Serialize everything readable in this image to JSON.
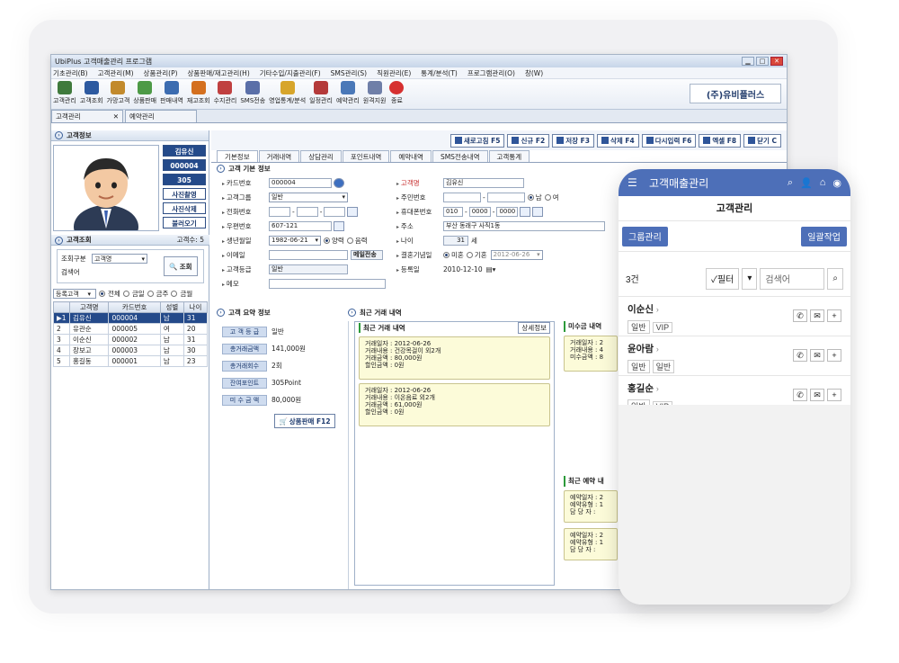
{
  "window": {
    "title": "UbiPlus 고객매출관리 프로그램"
  },
  "menu": [
    "기초관리(B)",
    "고객관리(M)",
    "상품관리(P)",
    "상품판매/재고관리(H)",
    "기타수입/지출관리(F)",
    "SMS관리(S)",
    "직원관리(E)",
    "통계/분석(T)",
    "프로그램관리(O)",
    "창(W)"
  ],
  "toolbar": {
    "items": [
      "고객관리",
      "고객조회",
      "가망고객",
      "상품판매",
      "판매내역",
      "재고조회",
      "수지관리",
      "SMS전송",
      "영업통계/분석",
      "일정관리",
      "예약관리",
      "원격지원",
      "종료"
    ],
    "brand": "(주)유비플러스"
  },
  "doc_tabs": [
    "고객관리",
    "예약관리"
  ],
  "left": {
    "info_title": "고객정보",
    "name": "김유신",
    "code": "000004",
    "num": "305",
    "btn_photo": "사진촬영",
    "btn_delete": "사진삭제",
    "btn_load": "불러오기",
    "search_title": "고객조회",
    "count": "고객수: 5",
    "search_type_label": "조회구분",
    "search_type_value": "고객명",
    "search_word_label": "검색어",
    "search_btn": "조회",
    "filter_select": "등록고객",
    "filters": [
      "전체",
      "금일",
      "금주",
      "금월"
    ],
    "grid_head": [
      "고객명",
      "카드번호",
      "성별",
      "나이"
    ],
    "grid_rows": [
      {
        "no": "▶1",
        "name": "김유신",
        "card": "000004",
        "sex": "남",
        "age": "31"
      },
      {
        "no": "2",
        "name": "유관순",
        "card": "000005",
        "sex": "여",
        "age": "20"
      },
      {
        "no": "3",
        "name": "이순신",
        "card": "000002",
        "sex": "남",
        "age": "31"
      },
      {
        "no": "4",
        "name": "장보고",
        "card": "000003",
        "sex": "남",
        "age": "30"
      },
      {
        "no": "5",
        "name": "홍길동",
        "card": "000001",
        "sex": "남",
        "age": "23"
      }
    ]
  },
  "actions": [
    "새로고침 F5",
    "신규 F2",
    "저장 F3",
    "삭제 F4",
    "다시입력 F6",
    "엑셀 F8",
    "닫기 C"
  ],
  "subtabs": [
    "기본정보",
    "거래내역",
    "상담관리",
    "포인트내역",
    "예약내역",
    "SMS전송내역",
    "고객통계"
  ],
  "basic": {
    "title": "고객 기본 정보",
    "card_label": "카드번호",
    "card": "000004",
    "group_label": "고객그룹",
    "group": "일반",
    "phone_label": "전화번호",
    "zip_label": "우편번호",
    "zip": "607-121",
    "birth_label": "생년월일",
    "birth": "1982-06-21",
    "solar": "양력",
    "lunar": "음력",
    "email_label": "이메일",
    "email_btn": "메일전송",
    "grade_label": "고객등급",
    "grade": "일반",
    "memo_label": "메모",
    "name_label": "고객명",
    "name": "김유신",
    "rrn_label": "주민번호",
    "male": "남",
    "female": "여",
    "mobile_label": "휴대폰번호",
    "mobile1": "010",
    "mobile2": "0000",
    "mobile3": "0000",
    "addr_label": "주소",
    "addr": "부산 동래구 사직1동",
    "age_label": "나이",
    "age": "31",
    "age_unit": "세",
    "wed_label": "결혼기념일",
    "unmarried": "미혼",
    "married": "기혼",
    "wed_date": "2012-06-26",
    "reg_label": "등록일",
    "reg": "2010-12-10"
  },
  "summary": {
    "title": "고객 요약 정보",
    "rows": [
      {
        "label": "고 객 등 급",
        "value": "일반"
      },
      {
        "label": "총거래금액",
        "value": "141,000원"
      },
      {
        "label": "총거래회수",
        "value": "2회"
      },
      {
        "label": "잔여포인트",
        "value": "305Point"
      },
      {
        "label": "미 수 금 액",
        "value": "80,000원"
      }
    ],
    "btn": "상품판매 F12"
  },
  "recent": {
    "title": "최근 거래 내역",
    "inner_title": "최근 거래 내역",
    "detail_btn": "상세정보",
    "cards": [
      {
        "l1": "거래일자 : 2012-06-26",
        "l2": "거래내용 : 건강목걸이 외2개",
        "l3": "거래금액 : 80,000원",
        "l4": "할인금액 : 0원"
      },
      {
        "l1": "거래일자 : 2012-06-26",
        "l2": "거래내용 : 이온음료 외2개",
        "l3": "거래금액 : 61,000원",
        "l4": "할인금액 : 0원"
      }
    ],
    "unpaid_title": "미수금 내역",
    "unpaid_lines": [
      "거래일자 : 2",
      "거래내용 : 4",
      "미수금액 : 8"
    ],
    "reserve_title": "최근 예약 내",
    "reserve_lines": [
      "예약일자 : 2",
      "예약유형 : 1",
      "담 당 자 :"
    ]
  },
  "mobile": {
    "title": "고객매출관리",
    "subtitle": "고객관리",
    "btn_group": "그룹관리",
    "btn_batch": "일괄작업",
    "count": "3건",
    "filter": "✓필터",
    "search_placeholder": "검색어",
    "items": [
      {
        "name": "이순신",
        "tags": [
          "일반",
          "VIP"
        ]
      },
      {
        "name": "윤아람",
        "tags": [
          "일반",
          "일반"
        ]
      },
      {
        "name": "홍길순",
        "tags": [
          "일반",
          "VIP"
        ]
      }
    ]
  }
}
